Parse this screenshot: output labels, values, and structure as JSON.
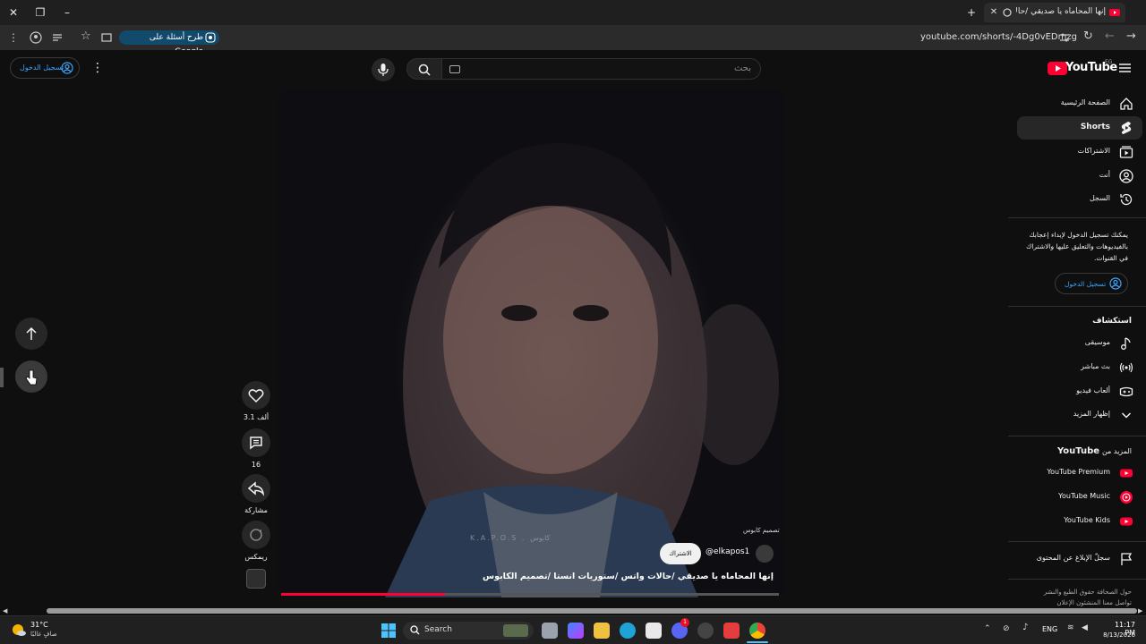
{
  "browser": {
    "tab_title": "إنها المحاماه يا صديقي /حالات",
    "url": "youtube.com/shorts/-4Dg0vEDmzg",
    "google_pill": "طرح أسئلة على Google"
  },
  "header": {
    "logo_text": "YouTube",
    "region": "EG",
    "search_placeholder": "بحث",
    "signin_label": "تسجيل الدخول"
  },
  "sidebar": {
    "main_items": [
      {
        "label": "الصفحة الرئيسية",
        "icon": "home-icon"
      },
      {
        "label": "Shorts",
        "icon": "shorts-icon",
        "active": true
      },
      {
        "label": "الاشتراكات",
        "icon": "subscriptions-icon"
      },
      {
        "label": "أنت",
        "icon": "account-icon"
      },
      {
        "label": "السجل",
        "icon": "history-icon"
      }
    ],
    "signin_prompt": "يمكنك تسجيل الدخول لإبداء إعجابك بالفيديوهات والتعليق عليها والاشتراك في القنوات.",
    "signin_button": "تسجيل الدخول",
    "explore_title": "استكشاف",
    "explore_items": [
      {
        "label": "موسيقى",
        "icon": "music-icon"
      },
      {
        "label": "بث مباشر",
        "icon": "live-icon"
      },
      {
        "label": "ألعاب فيديو",
        "icon": "gaming-icon"
      },
      {
        "label": "إظهار المزيد",
        "icon": "chevron-down-icon"
      }
    ],
    "more_title_prefix": "المزيد من",
    "more_title_brand": "YouTube",
    "more_items": [
      {
        "label": "YouTube Premium",
        "icon": "youtube-premium-icon"
      },
      {
        "label": "YouTube Music",
        "icon": "youtube-music-icon"
      },
      {
        "label": "YouTube Kids",
        "icon": "youtube-kids-icon"
      }
    ],
    "report_label": "سجلّ الإبلاغ عن المحتوى",
    "footer_line1": "حول  الصحافة  حقوق الطبع والنشر",
    "footer_line2": "تواصل معنا  المنشئون  الإعلان"
  },
  "video": {
    "title": "إنها المحاماه يا صديقي /حالات واتس /ستوريات انستا /تصميم الكابوس",
    "channel": "@elkapos1",
    "subscribe_label": "الاشتراك",
    "watermark": "K.A.P.O.S .  كابوس",
    "overlay_tag": "تصميم كابوس",
    "progress": 0.33,
    "actions": {
      "likes": "3.1 ألف",
      "comments": "16",
      "share": "مشاركة",
      "remix": "ريمكس"
    }
  },
  "taskbar": {
    "weather_temp": "31°C",
    "weather_desc": "صافٍ غالبًا",
    "search_label": "Search",
    "lang": "ENG",
    "time": "11:17 PM",
    "date": "8/13/2026",
    "badge_count": "1"
  }
}
